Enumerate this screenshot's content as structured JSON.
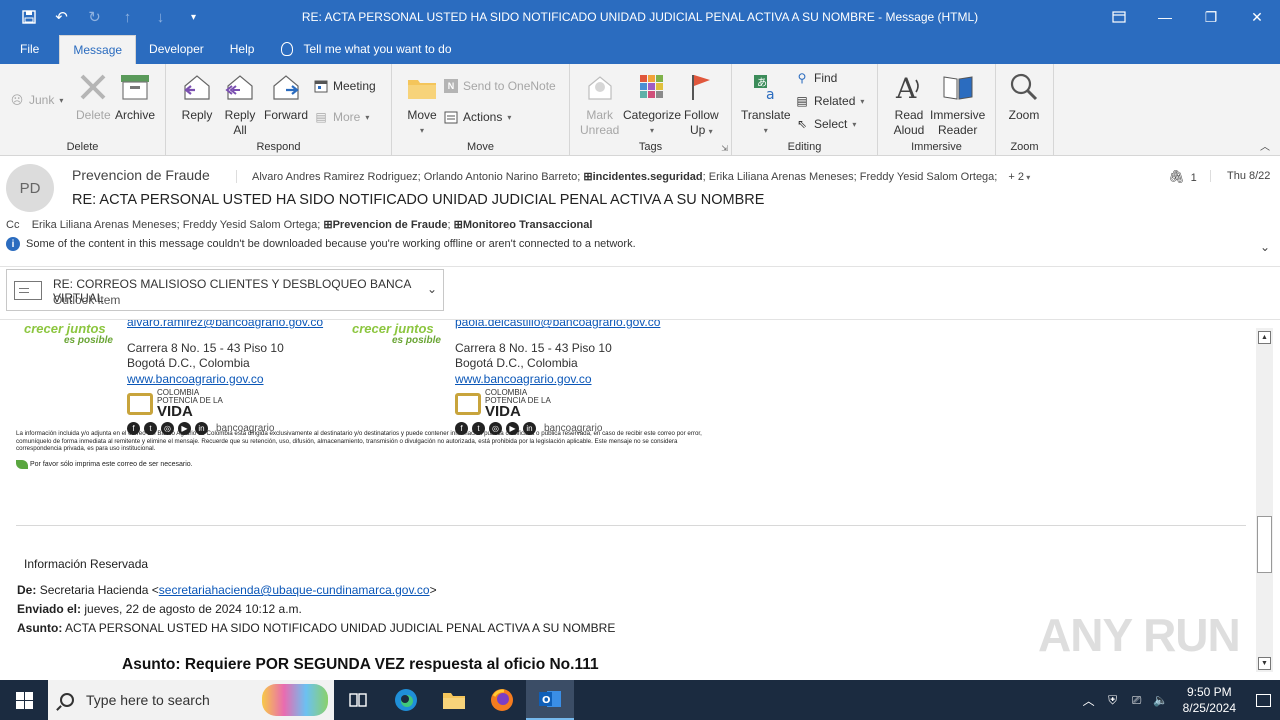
{
  "window": {
    "title": "RE: ACTA PERSONAL USTED HA SIDO NOTIFICADO UNIDAD JUDICIAL PENAL ACTIVA A SU NOMBRE  -  Message (HTML)"
  },
  "ribbon_tabs": {
    "file": "File",
    "message": "Message",
    "developer": "Developer",
    "help": "Help",
    "tell_me": "Tell me what you want to do"
  },
  "ribbon": {
    "delete_group": {
      "label": "Delete",
      "junk": "Junk",
      "delete": "Delete",
      "archive": "Archive"
    },
    "respond_group": {
      "label": "Respond",
      "reply": "Reply",
      "reply_all_1": "Reply",
      "reply_all_2": "All",
      "forward": "Forward",
      "meeting": "Meeting",
      "more": "More"
    },
    "move_group": {
      "label": "Move",
      "move": "Move",
      "send_onenote": "Send to OneNote",
      "actions": "Actions"
    },
    "tags_group": {
      "label": "Tags",
      "mark_unread_1": "Mark",
      "mark_unread_2": "Unread",
      "categorize": "Categorize",
      "follow_up_1": "Follow",
      "follow_up_2": "Up"
    },
    "editing_group": {
      "label": "Editing",
      "translate": "Translate",
      "find": "Find",
      "related": "Related",
      "select": "Select"
    },
    "immersive_group": {
      "label": "Immersive",
      "read_aloud_1": "Read",
      "read_aloud_2": "Aloud",
      "immersive_reader_1": "Immersive",
      "immersive_reader_2": "Reader"
    },
    "zoom_group": {
      "label": "Zoom",
      "zoom": "Zoom"
    }
  },
  "message": {
    "avatar_initials": "PD",
    "sender": "Prevencion de Fraude",
    "to_prefix": "Alvaro Andres Ramirez Rodriguez; Orlando Antonio Narino Barreto; ",
    "to_group": "incidentes.seguridad",
    "to_suffix": "; Erika Liliana Arenas Meneses; Freddy Yesid Salom Ortega;",
    "to_more": "+ 2",
    "subject": "RE: ACTA PERSONAL USTED HA SIDO NOTIFICADO UNIDAD JUDICIAL PENAL ACTIVA A SU NOMBRE",
    "attachment_count": "1",
    "date": "Thu 8/22",
    "cc_label": "Cc",
    "cc_prefix": "Erika Liliana Arenas Meneses; Freddy Yesid Salom Ortega;",
    "cc_group1": "Prevencion de Fraude",
    "cc_group2": "Monitoreo Transaccional",
    "info_text": "Some of the content in this message couldn't be downloaded because you're working offline or aren't connected to a network."
  },
  "attachment": {
    "title": "RE: CORREOS MALISIOSO CLIENTES Y DESBLOQUEO BANCA VIRTUAL",
    "type": "Outlook item"
  },
  "body": {
    "sig1": {
      "email": "alvaro.ramirez@bancoagrario.gov.co",
      "address": "Carrera 8 No. 15 - 43 Piso 10",
      "city": "Bogotá D.C., Colombia",
      "web": "www.bancoagrario.gov.co"
    },
    "sig2": {
      "email": "paola.delcastillo@bancoagrario.gov.co",
      "address": "Carrera 8 No. 15 - 43 Piso 10",
      "city": "Bogotá D.C., Colombia",
      "web": "www.bancoagrario.gov.co"
    },
    "slogan_main": "crecer juntos",
    "slogan_sub": "es posible",
    "vida_top": "COLOMBIA",
    "vida_mid": "POTENCIA DE LA",
    "vida_word": "VIDA",
    "brand": "bancoagrario",
    "disclaimer": "La información incluida y/o adjunta en el correo del Banco Agrario de Colombia está dirigida exclusivamente al destinatario y/o destinatarios y puede contener información pública clasificada o pública reservada, en caso de recibir este correo por error, comuníquelo de forma inmediata al remitente y elimine el mensaje. Recuerde que su retención, uso, difusión, almacenamiento, transmisión o divulgación no autorizada, está prohibida por la legislación aplicable. Este mensaje no se considera correspondencia privada, es para uso institucional.",
    "print_note": "Por favor sólo imprima este correo de ser necesario.",
    "reservada": "Información Reservada",
    "de_label": "De:",
    "de_name": "Secretaria Hacienda <",
    "de_email": "secretariahacienda@ubaque-cundinamarca.gov.co",
    "de_close": ">",
    "enviado_label": "Enviado el:",
    "enviado_value": "jueves, 22 de agosto de 2024 10:12 a.m.",
    "asunto_label": "Asunto:",
    "asunto_value": "ACTA PERSONAL USTED HA SIDO NOTIFICADO UNIDAD JUDICIAL PENAL ACTIVA A SU NOMBRE",
    "asunto2": "Asunto: Requiere POR SEGUNDA VEZ respuesta al oficio No.111"
  },
  "watermark": "ANY RUN",
  "taskbar": {
    "search_placeholder": "Type here to search",
    "time": "9:50 PM",
    "date": "8/25/2024"
  },
  "colors": {
    "accent": "#2b6cbf",
    "link": "#0b57b8",
    "taskbar": "#1b2b40"
  }
}
